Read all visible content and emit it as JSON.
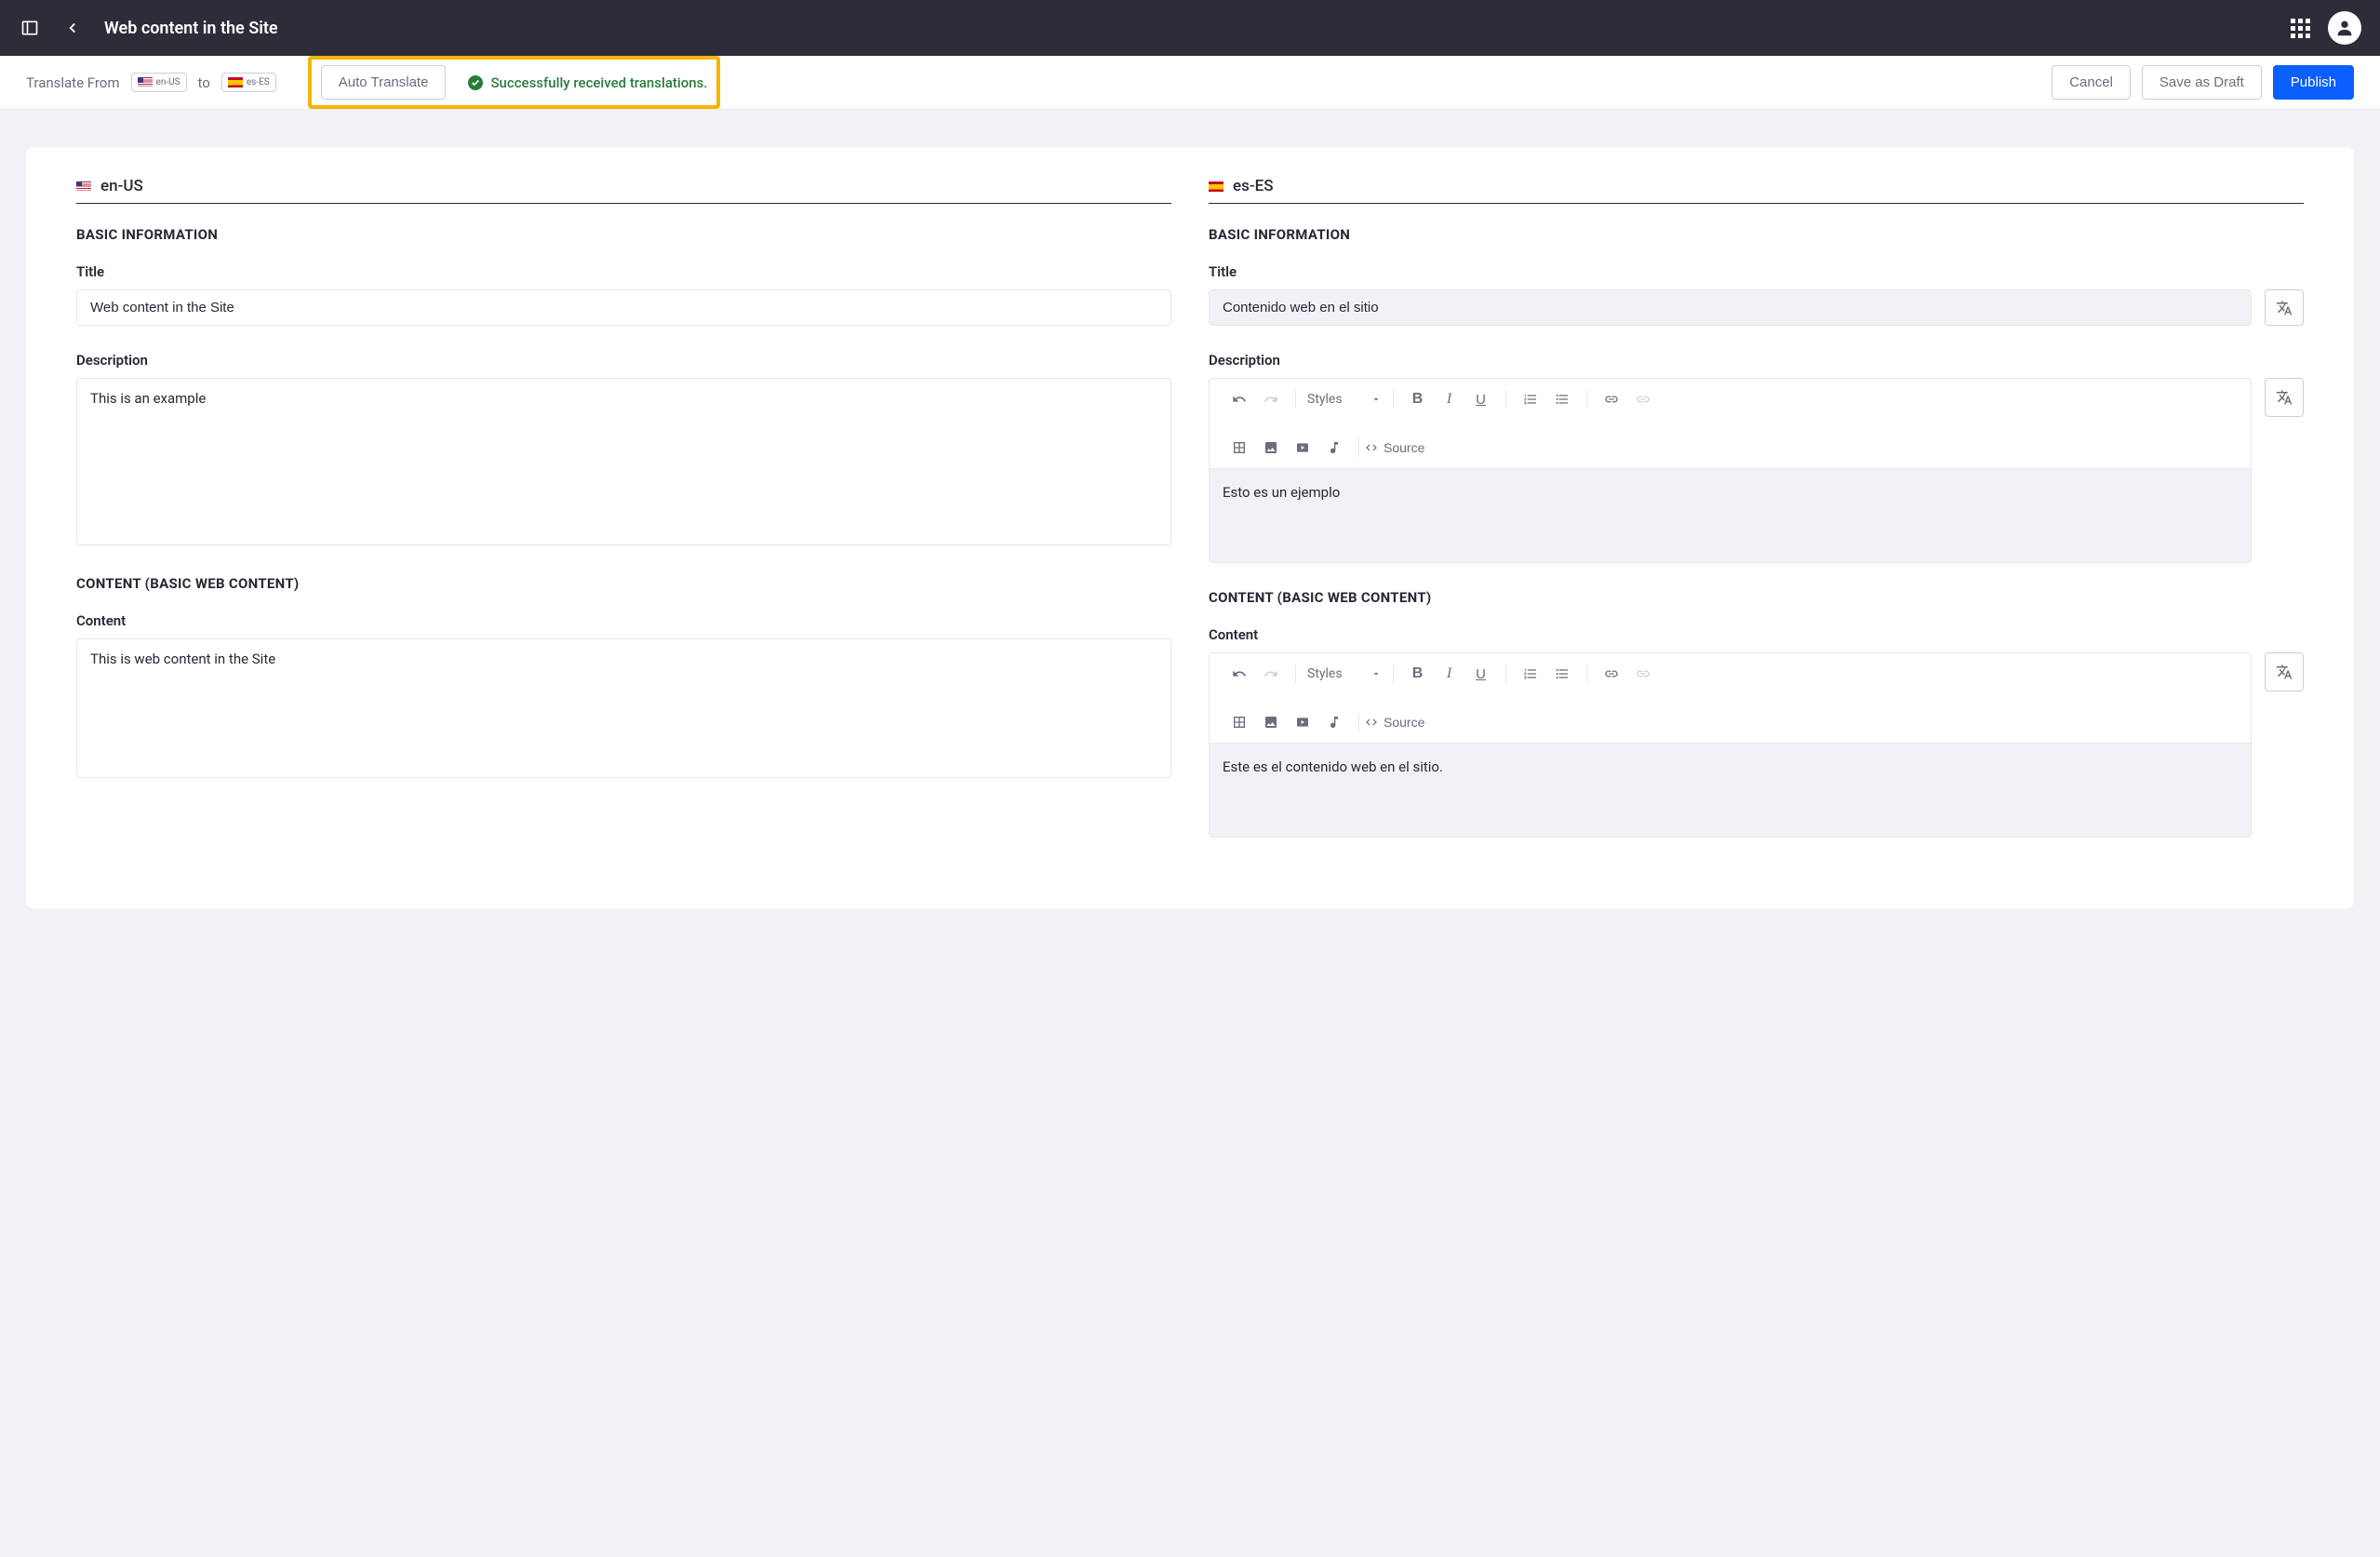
{
  "header": {
    "title": "Web content in the Site"
  },
  "toolbar": {
    "translate_from_label": "Translate From",
    "to_label": "to",
    "source_locale": "en-US",
    "target_locale": "es-ES",
    "auto_translate_label": "Auto Translate",
    "success_message": "Successfully received translations.",
    "cancel_label": "Cancel",
    "save_draft_label": "Save as Draft",
    "publish_label": "Publish"
  },
  "editor_labels": {
    "styles": "Styles",
    "source": "Source"
  },
  "source_col": {
    "locale": "en-US",
    "sections": {
      "basic_info": "BASIC INFORMATION",
      "content": "CONTENT (BASIC WEB CONTENT)"
    },
    "fields": {
      "title_label": "Title",
      "title_value": "Web content in the Site",
      "description_label": "Description",
      "description_value": "This is an example",
      "content_label": "Content",
      "content_value": "This is web content in the Site"
    }
  },
  "target_col": {
    "locale": "es-ES",
    "sections": {
      "basic_info": "BASIC INFORMATION",
      "content": "CONTENT (BASIC WEB CONTENT)"
    },
    "fields": {
      "title_label": "Title",
      "title_value": "Contenido web en el sitio",
      "description_label": "Description",
      "description_value": "Esto es un ejemplo",
      "content_label": "Content",
      "content_value": "Este es el contenido web en el sitio."
    }
  }
}
